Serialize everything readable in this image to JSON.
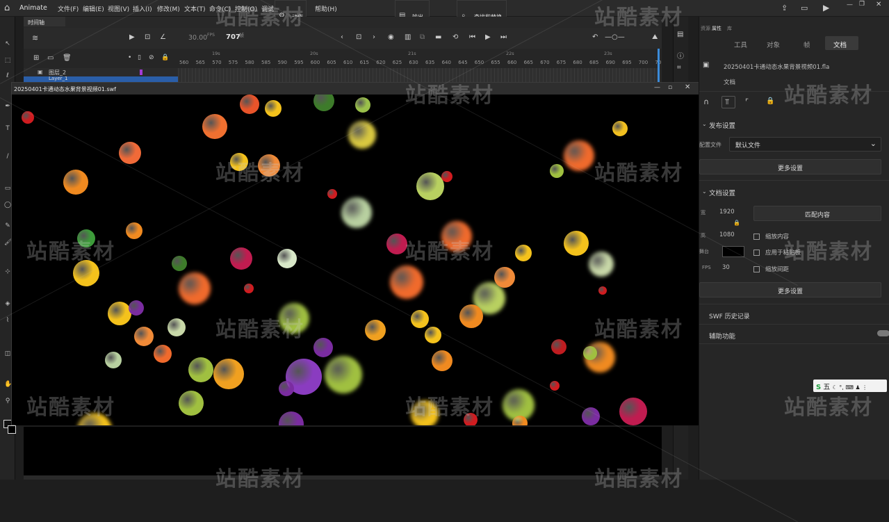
{
  "app": {
    "name": "Animate"
  },
  "menu": [
    "文件(F)",
    "编辑(E)",
    "视图(V)",
    "插入(I)",
    "修改(M)",
    "文本(T)",
    "命令(C)",
    "控制(O)",
    "调试",
    "帮助(H)"
  ],
  "floating_panels": {
    "action": "动作",
    "output": "输出",
    "find_replace": "查找和替换"
  },
  "timeline": {
    "tab_label": "时间轴",
    "fps": "30.00",
    "fps_unit": "FPS",
    "frame": "707",
    "frame_unit": "帧",
    "ruler_numbers": [
      "560",
      "565",
      "570",
      "575",
      "580",
      "585",
      "590",
      "595",
      "600",
      "605",
      "610",
      "615",
      "620",
      "625",
      "630",
      "635",
      "640",
      "645",
      "650",
      "655",
      "660",
      "665",
      "670",
      "675",
      "680",
      "685",
      "690",
      "695",
      "700",
      "70"
    ],
    "ruler_seconds": [
      "19s",
      "20s",
      "21s",
      "22s",
      "23s"
    ],
    "layers": [
      "图层_2",
      "Layer_1"
    ]
  },
  "stage": {
    "window_title": "20250401卡通动态水果背景视频01.swf"
  },
  "properties": {
    "tabs_top": [
      "资源",
      "属性",
      "库"
    ],
    "tabs": [
      "工具",
      "对象",
      "帧",
      "文档"
    ],
    "active_tab": "文档",
    "file_name": "20250401卡通动态水果背景视频01.fla",
    "doc_label": "文档",
    "publish_section": "发布设置",
    "profile_label": "配置文件",
    "profile_value": "默认文件",
    "more_settings": "更多设置",
    "doc_settings_section": "文档设置",
    "width_value": "1920",
    "height_value": "1080",
    "match_content": "匹配内容",
    "scale_content": "缩放内容",
    "apply_pasteboard": "应用于粘贴板",
    "scale_spacing": "缩放间距",
    "bg_label": "舞台",
    "fps_label": "FPS",
    "fps_value": "30",
    "more_settings_2": "更多设置",
    "swf_history": "SWF 历史记录",
    "accessibility": "辅助功能"
  },
  "ime": {
    "label": "五"
  },
  "watermark_text": "站酷素材",
  "colors": {
    "accent": "#3b8bd9",
    "panel_bg": "#262626",
    "stage_bg": "#000000"
  }
}
